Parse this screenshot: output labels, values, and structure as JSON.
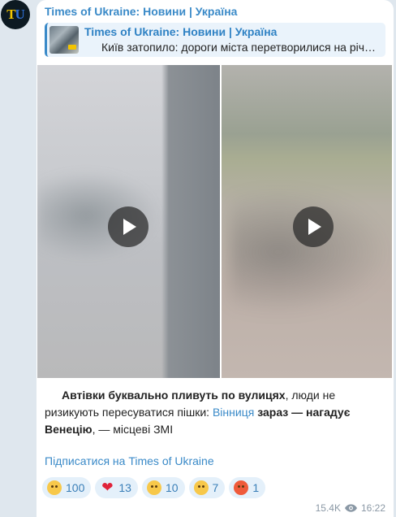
{
  "channel": {
    "avatar_letters": [
      "T",
      "U"
    ],
    "name": "Times of Ukraine: Новини | Україна"
  },
  "forward": {
    "title": "Times of Ukraine: Новини | Україна",
    "preview_text": "Київ затопило: дороги міста перетворилися на річ…"
  },
  "message": {
    "bold_1": "Автівки буквально пливуть по вулицях",
    "text_1": ", люди не ризикують пересуватися пішки: ",
    "link_city": "Вінниця",
    "bold_2": " зараз — нагадує Венецію",
    "text_2": ", — місцеві ЗМІ"
  },
  "subscribe_label": "Підписатися на Times of Ukraine",
  "reactions": [
    {
      "emoji": "crying-face",
      "count": "100"
    },
    {
      "emoji": "red-heart",
      "count": "13"
    },
    {
      "emoji": "grinning-face",
      "count": "10"
    },
    {
      "emoji": "thinking-face",
      "count": "7"
    },
    {
      "emoji": "angry-face",
      "count": "1"
    }
  ],
  "meta": {
    "views": "15.4K",
    "time": "16:22"
  },
  "colors": {
    "accent": "#3a8ac8",
    "chat_background": "#dfe7ee",
    "bubble": "#ffffff",
    "reaction_bg": "#e4f0fa"
  }
}
